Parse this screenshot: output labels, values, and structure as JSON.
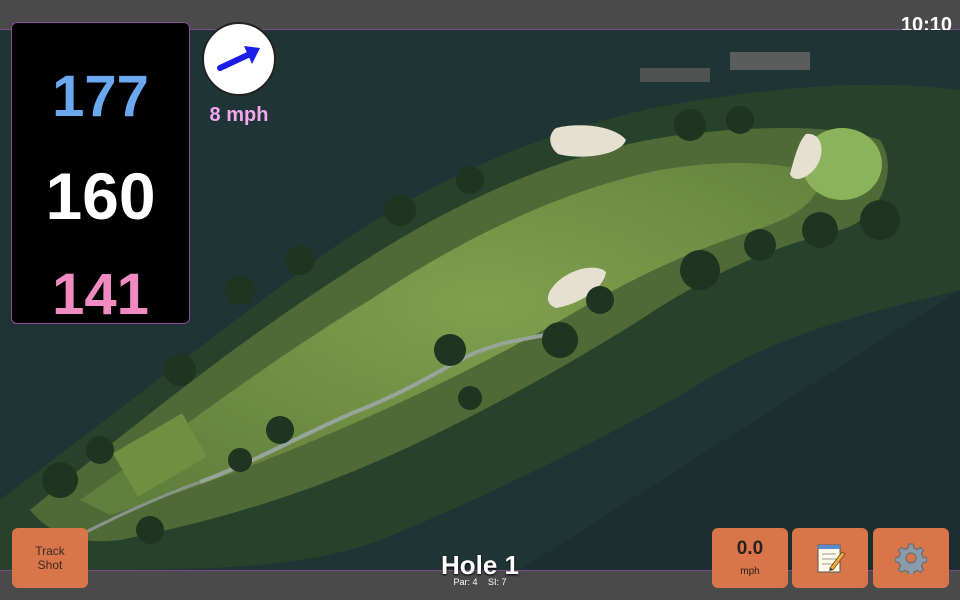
{
  "status": {
    "time": "10:10"
  },
  "distances": {
    "back": "177",
    "middle": "160",
    "front": "141"
  },
  "wind": {
    "speed": "8 mph",
    "icon": "wind-direction-arrow-icon"
  },
  "hole": {
    "title": "Hole 1",
    "par": "Par: 4",
    "stroke_index": "SI: 7"
  },
  "controls": {
    "track_shot_line1": "Track",
    "track_shot_line2": "Shot",
    "speed_value": "0.0",
    "speed_unit": "mph",
    "notes_icon": "notepad-icon",
    "settings_icon": "gear-icon"
  },
  "colors": {
    "back_distance": "#6aa8f0",
    "middle_distance": "#ffffff",
    "front_distance": "#f08ac0",
    "button": "#d8764a",
    "wind_text": "#f4a6ee"
  }
}
